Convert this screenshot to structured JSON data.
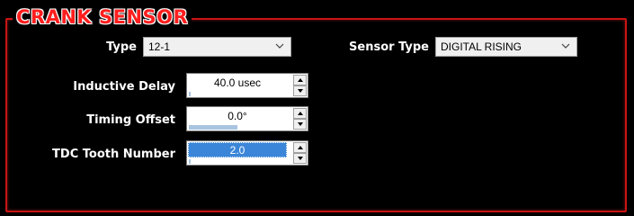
{
  "panel": {
    "title": "CRANK SENSOR"
  },
  "type_field": {
    "label": "Type",
    "value": "12-1"
  },
  "sensor_type_field": {
    "label": "Sensor Type",
    "value": "DIGITAL RISING"
  },
  "inductive_delay": {
    "label": "Inductive Delay",
    "value": "40.0 usec",
    "level": 0.02
  },
  "timing_offset": {
    "label": "Timing Offset",
    "value": "0.0°",
    "level": 0.5
  },
  "tdc_tooth_number": {
    "label": "TDC Tooth Number",
    "value": "2.0",
    "level": 0.02
  },
  "colors": {
    "frame": "#c81414",
    "title": "#ff1e1e",
    "selection": "#3b86d8",
    "bar": "#a8c4e0"
  },
  "icons": {
    "dropdown": "chevron-down-icon",
    "spin_up": "arrow-up-icon",
    "spin_down": "arrow-down-icon"
  }
}
